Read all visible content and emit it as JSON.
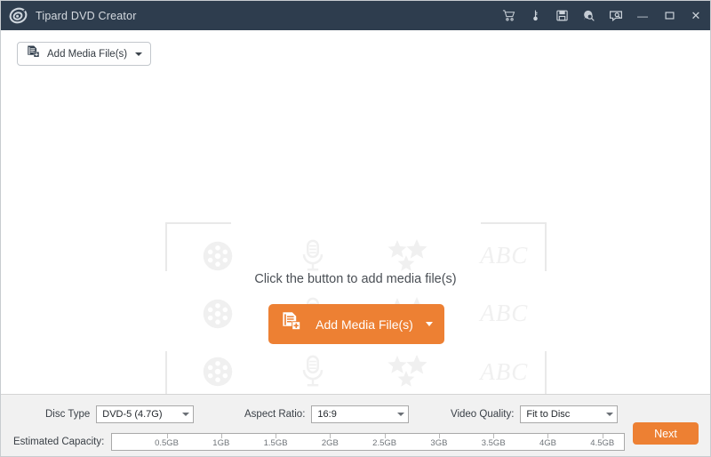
{
  "window": {
    "title": "Tipard DVD Creator",
    "logo_icon": "tipard-spiral-logo-icon",
    "titlebar_color": "#2e3d4e",
    "accent_color": "#ed8033",
    "icons": [
      {
        "name": "cart-icon",
        "tooltip": "Buy"
      },
      {
        "name": "key-icon",
        "tooltip": "Register"
      },
      {
        "name": "save-icon",
        "tooltip": "Save"
      },
      {
        "name": "search-help-icon",
        "tooltip": "Help"
      },
      {
        "name": "feedback-icon",
        "tooltip": "Feedback"
      }
    ],
    "controls": {
      "minimize": "—",
      "maximize": "□",
      "close": "✕"
    }
  },
  "toolbar": {
    "add_media_label": "Add Media File(s)",
    "add_media_icon": "add-file-icon",
    "dropdown_icon": "chevron-down-icon"
  },
  "main": {
    "hint_text": "Click the button to add media file(s)",
    "add_media_label": "Add Media File(s)",
    "add_media_icon": "add-file-icon",
    "dropdown_icon": "chevron-down-icon",
    "watermark_icons": [
      "film-reel-icon",
      "microphone-icon",
      "stars-icon",
      "abc-text-icon",
      "film-reel-icon",
      "microphone-icon",
      "stars-icon",
      "abc-text-icon",
      "film-reel-icon",
      "microphone-icon",
      "stars-icon",
      "abc-text-icon"
    ],
    "watermark_abc": "ABC"
  },
  "bottom": {
    "disc_type": {
      "label": "Disc Type",
      "value": "DVD-5 (4.7G)"
    },
    "aspect_ratio": {
      "label": "Aspect Ratio:",
      "value": "16:9"
    },
    "video_quality": {
      "label": "Video Quality:",
      "value": "Fit to Disc"
    },
    "capacity": {
      "label": "Estimated Capacity:",
      "min": 0,
      "max": 4.7,
      "ticks": [
        {
          "value": 0.5,
          "label": "0.5GB"
        },
        {
          "value": 1.0,
          "label": "1GB"
        },
        {
          "value": 1.5,
          "label": "1.5GB"
        },
        {
          "value": 2.0,
          "label": "2GB"
        },
        {
          "value": 2.5,
          "label": "2.5GB"
        },
        {
          "value": 3.0,
          "label": "3GB"
        },
        {
          "value": 3.5,
          "label": "3.5GB"
        },
        {
          "value": 4.0,
          "label": "4GB"
        },
        {
          "value": 4.5,
          "label": "4.5GB"
        }
      ],
      "used": 0
    },
    "next_label": "Next"
  }
}
